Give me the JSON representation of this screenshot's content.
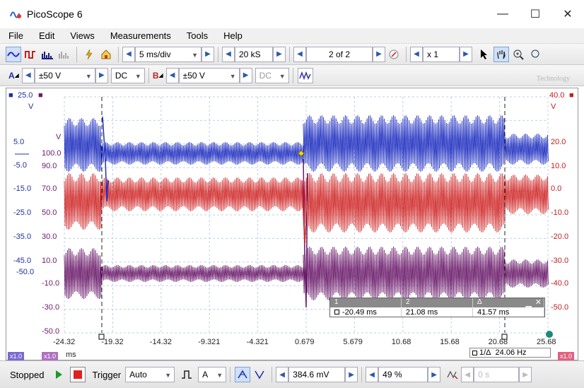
{
  "window": {
    "title": "PicoScope 6",
    "minimize": "—",
    "maximize": "☐",
    "close": "✕"
  },
  "menu": [
    {
      "label": "File"
    },
    {
      "label": "Edit"
    },
    {
      "label": "Views"
    },
    {
      "label": "Measurements"
    },
    {
      "label": "Tools"
    },
    {
      "label": "Help"
    }
  ],
  "toolbar1": {
    "timebase": "5 ms/div",
    "samples": "20 kS",
    "buffer": "2 of 2",
    "zoom": "x 1"
  },
  "toolbar2": {
    "channel_a": {
      "label": "A",
      "range": "±50 V",
      "coupling": "DC"
    },
    "channel_b": {
      "label": "B",
      "range": "±50 V",
      "coupling": "DC"
    }
  },
  "watermark": "Technology",
  "axes": {
    "blue": {
      "top": "25.0",
      "unit": "V",
      "ticks": [
        "5.0",
        "-5.0",
        "-15.0",
        "-25.0",
        "-35.0",
        "-45.0"
      ]
    },
    "blue_extra": "-50.0",
    "purple": {
      "unit": "V",
      "ticks": [
        "100.0",
        "90.0",
        "70.0",
        "50.0",
        "30.0",
        "10.0",
        "-10.0",
        "-30.0",
        "-50.0"
      ]
    },
    "red": {
      "top": "40.0",
      "unit": "V",
      "ticks": [
        "20.0",
        "10.0",
        "0.0",
        "-10.0",
        "-20.0",
        "-30.0",
        "-40.0",
        "-50.0"
      ]
    },
    "x": {
      "unit": "ms",
      "ticks": [
        "-24.32",
        "-19.32",
        "-14.32",
        "-9.321",
        "-4.321",
        "0.679",
        "5.679",
        "10.68",
        "15.68",
        "20.68",
        "25.68"
      ]
    }
  },
  "rulers": {
    "headers": [
      "1",
      "2",
      "Δ"
    ],
    "values": [
      "-20.49 ms",
      "21.08 ms",
      "41.57 ms"
    ],
    "freq_label": "1/Δ",
    "freq": "24.06 Hz"
  },
  "badges": {
    "a": "x1.0",
    "b": "x1.0",
    "c": "x1.0"
  },
  "status": {
    "state": "Stopped",
    "trigger_label": "Trigger",
    "trigger_mode": "Auto",
    "trigger_channel": "A",
    "trigger_level": "384.6 mV",
    "pretrigger": "49 %",
    "delay": "0 s"
  },
  "colors": {
    "blue": "#1f2fc0",
    "red": "#d02a2a",
    "purple": "#6a1a6a"
  }
}
